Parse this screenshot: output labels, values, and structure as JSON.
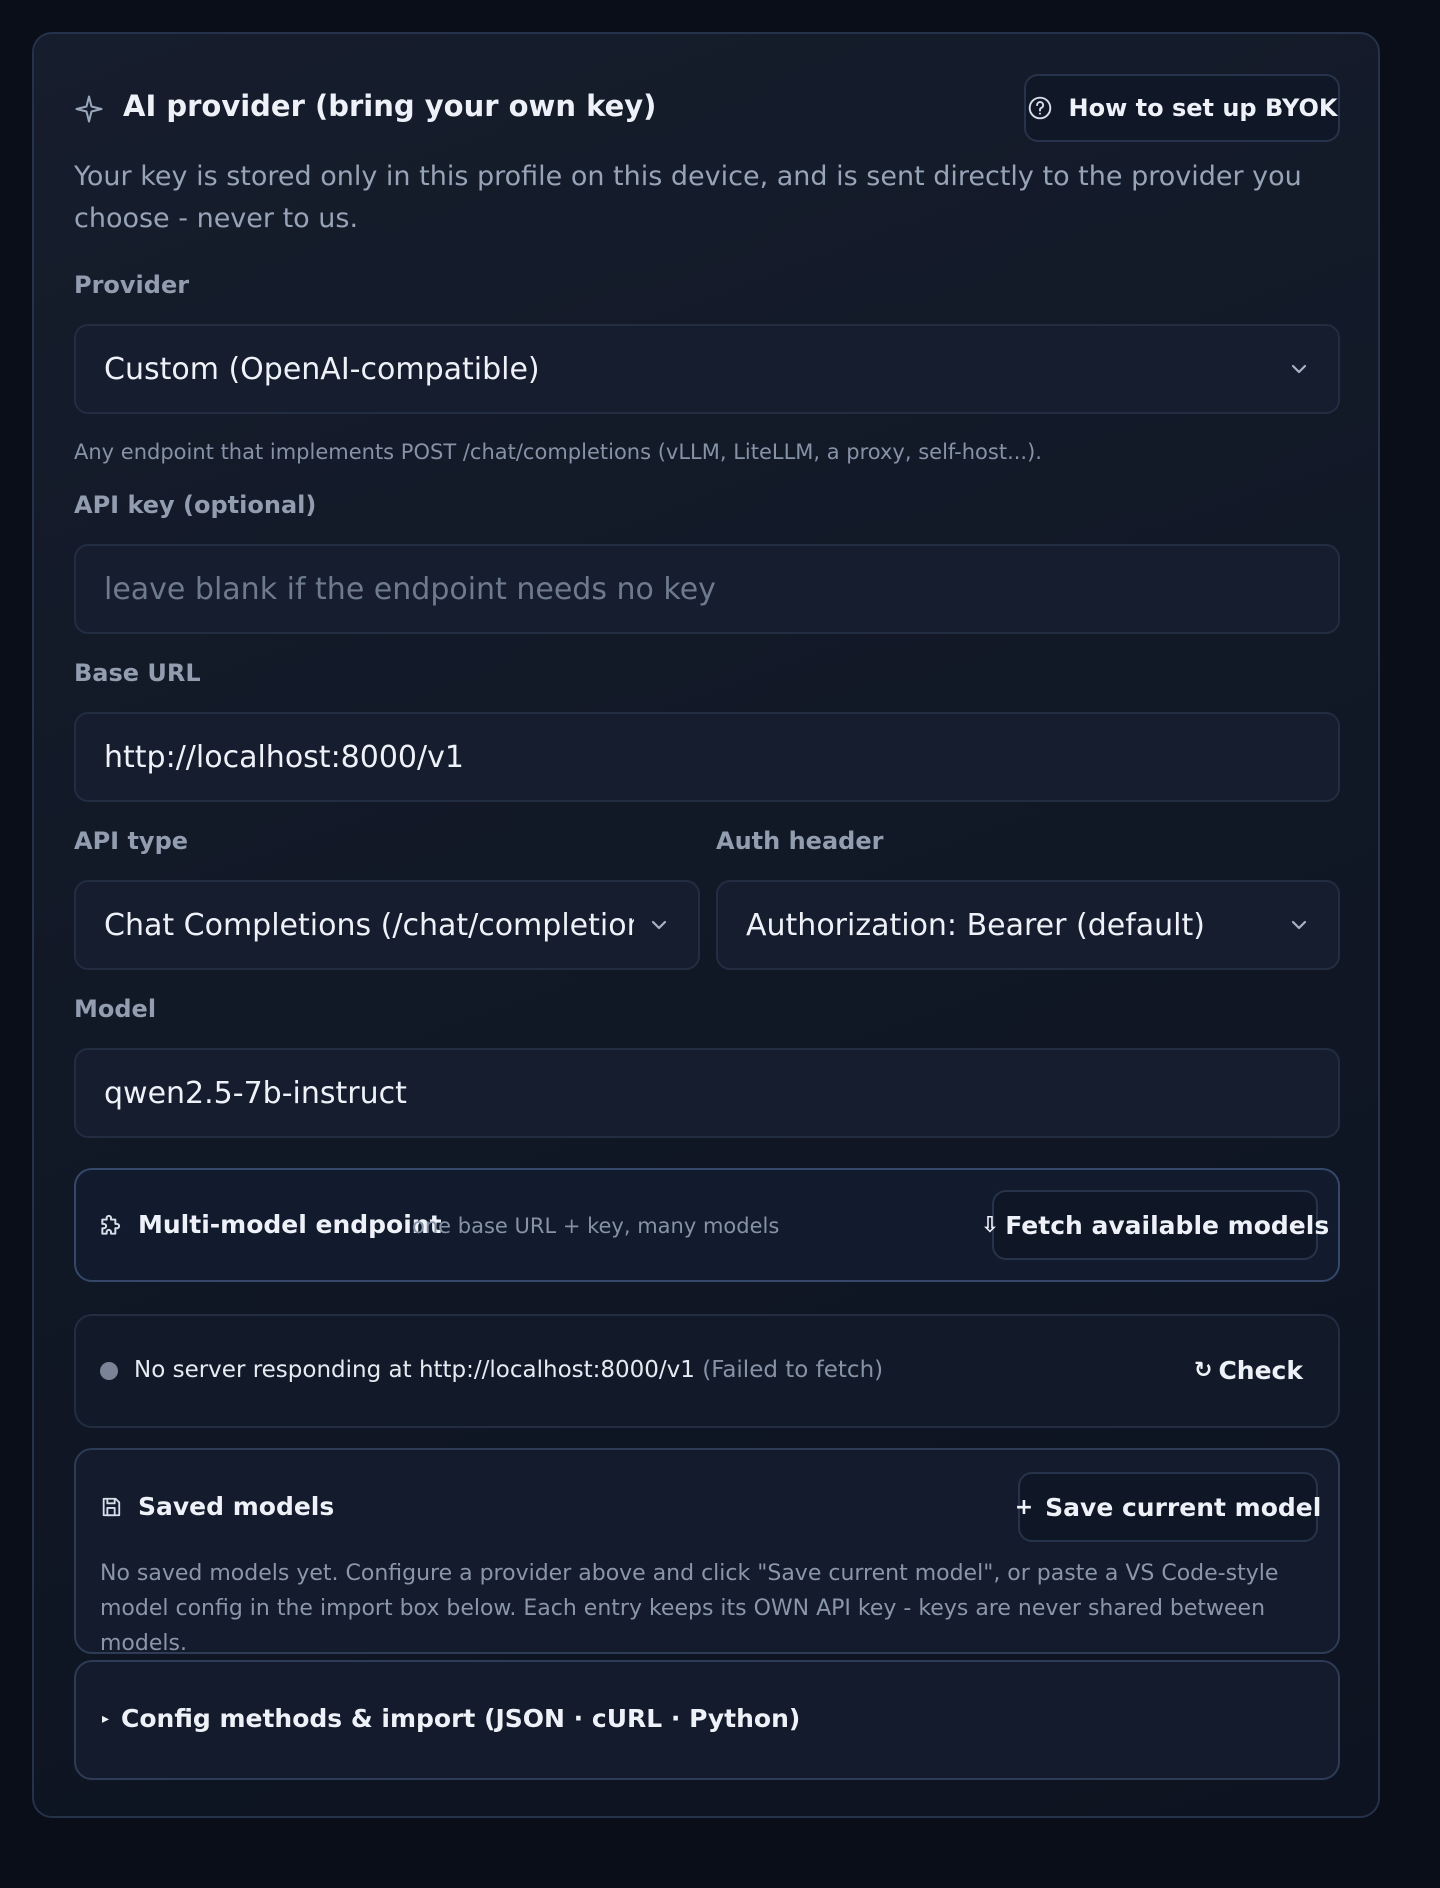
{
  "header": {
    "icon": "sparkle-icon",
    "title": "AI provider (bring your own key)",
    "help_button": {
      "icon": "help-circle-icon",
      "label": "How to set up BYOK"
    },
    "description": "Your key is stored only in this profile on this device, and is sent directly to the provider you choose - never to us."
  },
  "provider": {
    "label": "Provider",
    "value": "Custom (OpenAI-compatible)",
    "hint": "Any endpoint that implements POST /chat/completions (vLLM, LiteLLM, a proxy, self-host...)."
  },
  "api_key": {
    "label": "API key (optional)",
    "value": "",
    "placeholder": "leave blank if the endpoint needs no key"
  },
  "base_url": {
    "label": "Base URL",
    "value": "http://localhost:8000/v1"
  },
  "api_type": {
    "label": "API type",
    "value": "Chat Completions (/chat/completions)"
  },
  "auth_header": {
    "label": "Auth header",
    "value": "Authorization: Bearer (default)"
  },
  "model": {
    "label": "Model",
    "value": "qwen2.5-7b-instruct"
  },
  "multi_model": {
    "icon": "puzzle-icon",
    "title": "Multi-model endpoint",
    "subtitle": "one base URL + key, many models",
    "fetch_button": {
      "icon": "download-arrow-icon",
      "glyph": "⇩",
      "label": "Fetch available models"
    }
  },
  "status": {
    "dot_color": "#7b8496",
    "message": "No server responding at http://localhost:8000/v1",
    "error": "(Failed to fetch)",
    "check_button": {
      "icon": "refresh-icon",
      "glyph": "↻",
      "label": "Check"
    }
  },
  "saved_models": {
    "icon": "save-icon",
    "title": "Saved models",
    "save_button": {
      "icon": "plus-icon",
      "glyph": "+",
      "label": "Save current model"
    },
    "empty_text": "No saved models yet. Configure a provider above and click \"Save current model\", or paste a VS Code-style model config in the import box below. Each entry keeps its OWN API key - keys are never shared between models."
  },
  "config_import": {
    "icon": "disclosure-triangle-icon",
    "glyph": "▸",
    "label": "Config methods & import (JSON · cURL · Python)"
  },
  "colors": {
    "background": "#090e18",
    "card": "#131a28",
    "border": "#25324a",
    "text": "#eef2f8",
    "muted": "#8692a6"
  }
}
